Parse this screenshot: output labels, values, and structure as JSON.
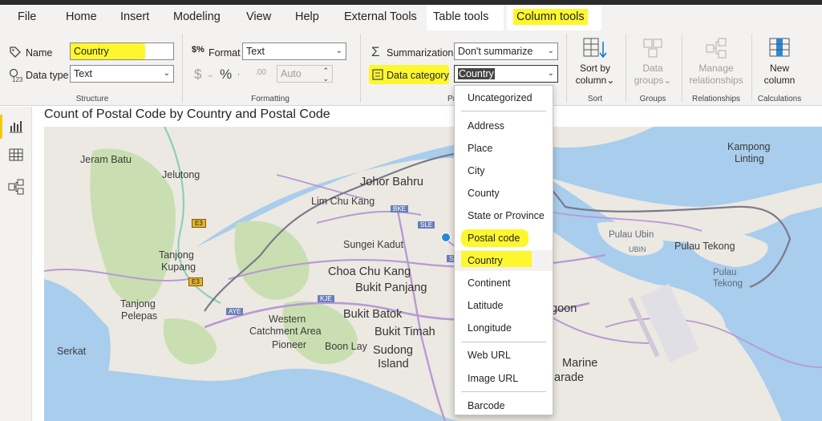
{
  "tabs": [
    {
      "label": "File"
    },
    {
      "label": "Home"
    },
    {
      "label": "Insert"
    },
    {
      "label": "Modeling"
    },
    {
      "label": "View"
    },
    {
      "label": "Help"
    },
    {
      "label": "External Tools"
    },
    {
      "label": "Table tools"
    },
    {
      "label": "Column tools"
    }
  ],
  "structure": {
    "name_label": "Name",
    "name_value": "Country",
    "datatype_label": "Data type",
    "datatype_value": "Text",
    "group_label": "Structure"
  },
  "formatting": {
    "format_label": "Format",
    "format_value": "Text",
    "auto_value": "Auto",
    "group_label": "Formatting",
    "currency_symbol": "$",
    "percent_symbol": "%"
  },
  "properties": {
    "summarization_label": "Summarization",
    "summarization_value": "Don't summarize",
    "datacategory_label": "Data category",
    "datacategory_value": "Country",
    "group_label": "Pr"
  },
  "sort": {
    "label_line1": "Sort by",
    "label_line2": "column",
    "group_label": "Sort"
  },
  "groups": {
    "label_line1": "Data",
    "label_line2": "groups",
    "group_label": "Groups"
  },
  "relationships": {
    "label_line1": "Manage",
    "label_line2": "relationships",
    "group_label": "Relationships"
  },
  "calculations": {
    "label_line1": "New",
    "label_line2": "column",
    "group_label": "Calculations"
  },
  "visual": {
    "title": "Count of Postal Code by Country and Postal Code"
  },
  "map_labels": [
    "Jeram Batu",
    "Jelutong",
    "Johor Bahru",
    "Lim Chu Kang",
    "Kampong",
    "Linting",
    "Tanjong",
    "Kupang",
    "Sungei Kadut",
    "Choa Chu Kang",
    "Bukit Panjang",
    "Tanjong",
    "Pelepas",
    "Western",
    "Catchment Area",
    "Bukit Batok",
    "Bukit Timah",
    "Pioneer",
    "Boon Lay",
    "Sudong",
    "Island",
    "Serkat",
    "Pulau Ubin",
    "Pulau Tekong",
    "Pulau",
    "Tekong",
    "goon",
    "Marine",
    "arade",
    "UBIN"
  ],
  "road_badges": [
    "E3",
    "E3",
    "BKE",
    "SLE",
    "KJE",
    "AYE",
    "SL"
  ],
  "dropdown": {
    "items": [
      "Uncategorized",
      "Address",
      "Place",
      "City",
      "County",
      "State or Province",
      "Postal code",
      "Country",
      "Continent",
      "Latitude",
      "Longitude",
      "Web URL",
      "Image URL",
      "Barcode"
    ]
  },
  "colors": {
    "highlight": "#fdf72f",
    "water": "#a9cdec",
    "land": "#ece9e2",
    "park": "#c9dfb2",
    "road_purple": "#b89ad4",
    "road_green": "#8ccfb6"
  }
}
